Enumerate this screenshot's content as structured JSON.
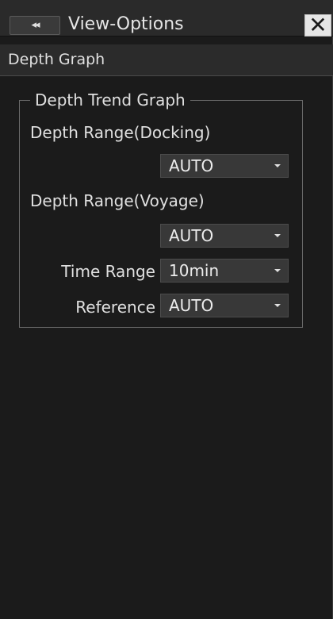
{
  "window": {
    "title": "View-Options",
    "back_label": "◂◂",
    "close_label": "✕"
  },
  "section": {
    "title": "Depth Graph"
  },
  "group": {
    "title": "Depth Trend Graph",
    "depth_range_docking": {
      "label": "Depth Range(Docking)",
      "value": "AUTO"
    },
    "depth_range_voyage": {
      "label": "Depth Range(Voyage)",
      "value": "AUTO"
    },
    "time_range": {
      "label": "Time Range",
      "value": "10min"
    },
    "reference": {
      "label": "Reference",
      "value": "AUTO"
    }
  }
}
